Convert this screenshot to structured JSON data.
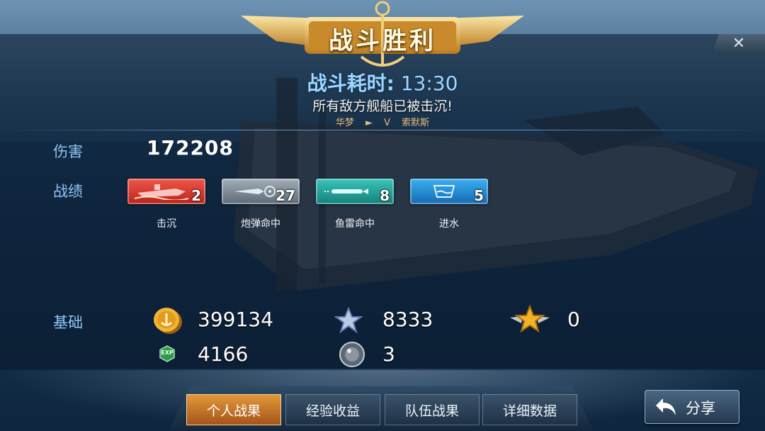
{
  "header": {
    "title": "战斗胜利",
    "close_label": "✕"
  },
  "battle": {
    "time_label": "战斗耗时:",
    "time_value": "13:30",
    "result_message": "所有敌方舰船已被击沉!",
    "player_left": "华梦",
    "versus": "V",
    "player_right": "索默斯"
  },
  "damage": {
    "label": "伤害",
    "value": "172208"
  },
  "record": {
    "label": "战绩",
    "items": [
      {
        "name": "击沉",
        "count": "2",
        "icon": "sunk-ship-icon",
        "color": "#d6362a"
      },
      {
        "name": "炮弹命中",
        "count": "27",
        "icon": "shell-hit-icon",
        "color": "#7c8a96"
      },
      {
        "name": "鱼雷命中",
        "count": "8",
        "icon": "torpedo-hit-icon",
        "color": "#1fa7a0"
      },
      {
        "name": "进水",
        "count": "5",
        "icon": "flooding-icon",
        "color": "#1d8fd8"
      }
    ]
  },
  "base": {
    "label": "基础",
    "gold": "399134",
    "star": "8333",
    "rank_star": "0",
    "exp": "4166",
    "medal": "3",
    "exp_icon_text": "EXP"
  },
  "tabs": [
    {
      "label": "个人战果",
      "active": true
    },
    {
      "label": "经验收益",
      "active": false
    },
    {
      "label": "队伍战果",
      "active": false
    },
    {
      "label": "详细数据",
      "active": false
    }
  ],
  "share_label": "分享",
  "colors": {
    "accent_gold": "#e39a3a",
    "label_blue": "#8ec6f4",
    "time_blue": "#9fd6ff",
    "player_name": "#e8b87a"
  }
}
